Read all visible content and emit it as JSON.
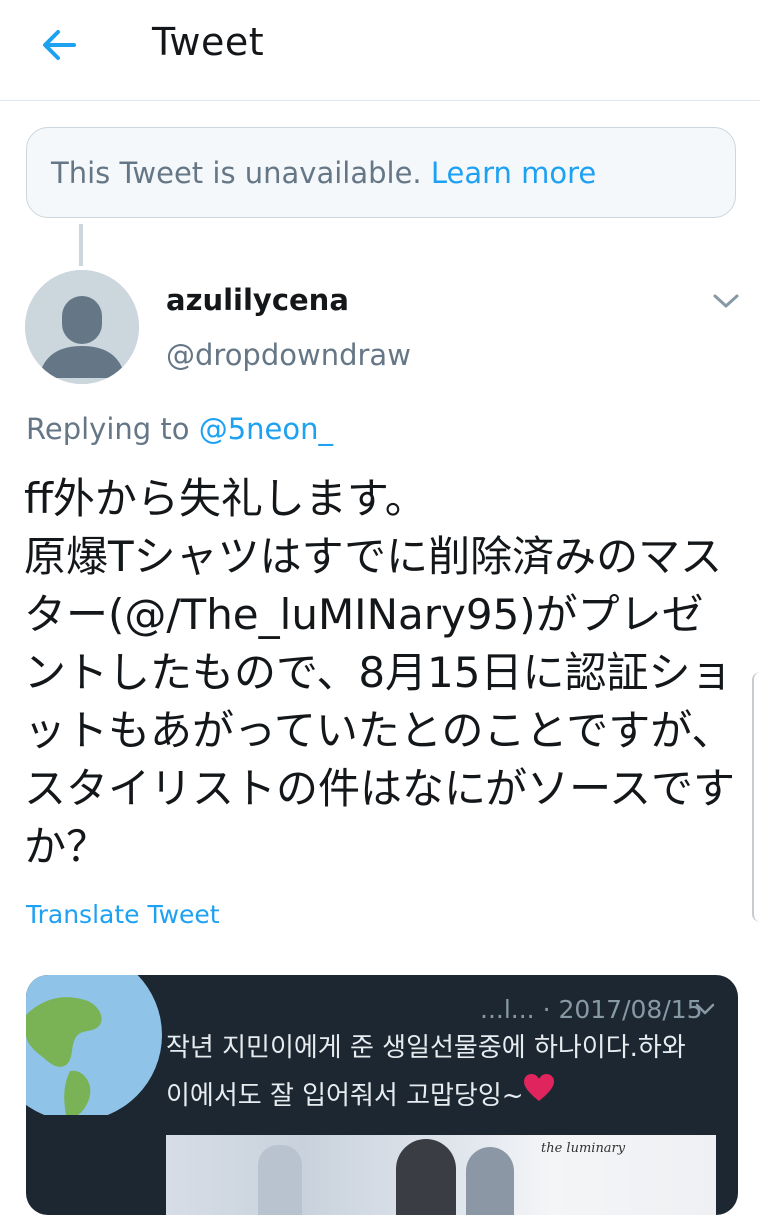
{
  "header": {
    "title": "Tweet",
    "back_icon": "arrow-left-icon",
    "accent_color": "#1da1f2"
  },
  "unavailable": {
    "message": "This Tweet is unavailable.",
    "link": "Learn more"
  },
  "tweet": {
    "author_name": "azulilycena",
    "author_handle": "@dropdowndraw",
    "replying_prefix": "Replying to",
    "replying_to": "@5neon_",
    "text": "ff外から失礼します。\n原爆Tシャツはすでに削除済みのマスター(@/The_luMINary95)がプレゼントしたもので、8月15日に認証ショットもあがっていたとのことですが、スタイリストの件はなにがソースですか？",
    "translate_label": "Translate Tweet"
  },
  "media": {
    "date": "...l... · 2017/08/15",
    "line1": "작년 지민이에게 준 생일선물중에 하나이다.하와",
    "line2": "이에서도 잘 입어줘서 고맙당잉~",
    "photo_label": "the luminary"
  }
}
